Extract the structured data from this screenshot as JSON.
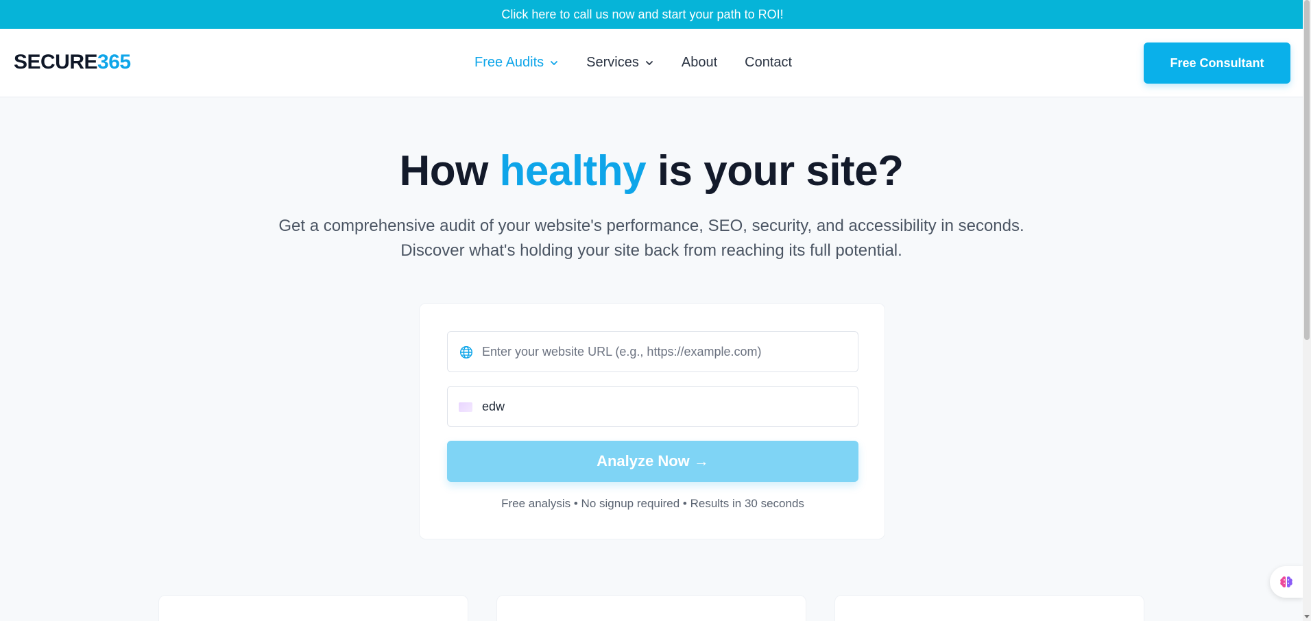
{
  "banner": {
    "text": "Click here to call us now and start your path to ROI!"
  },
  "header": {
    "logo_main": "SECURE",
    "logo_accent": "365",
    "nav": [
      {
        "label": "Free Audits",
        "has_dropdown": true,
        "active": true
      },
      {
        "label": "Services",
        "has_dropdown": true,
        "active": false
      },
      {
        "label": "About",
        "has_dropdown": false,
        "active": false
      },
      {
        "label": "Contact",
        "has_dropdown": false,
        "active": false
      }
    ],
    "cta_label": "Free Consultant"
  },
  "hero": {
    "title_before": "How ",
    "title_highlight": "healthy",
    "title_after": " is your site?",
    "subtitle": "Get a comprehensive audit of your website's performance, SEO, security, and accessibility in seconds. Discover what's holding your site back from reaching its full potential."
  },
  "form": {
    "url_placeholder": "Enter your website URL (e.g., https://example.com)",
    "url_value": "",
    "second_value": "edw",
    "submit_label": "Analyze Now →",
    "note": "Free analysis • No signup required • Results in 30 seconds"
  },
  "colors": {
    "accent": "#0ea5e9",
    "banner": "#06b4d8",
    "button_disabled": "#7fd4f5",
    "text_dark": "#131a2a"
  },
  "icons": {
    "url_field": "globe-icon",
    "second_field": "flag-icon",
    "nav_dropdown": "chevron-down-icon",
    "widget": "brain-icon"
  }
}
